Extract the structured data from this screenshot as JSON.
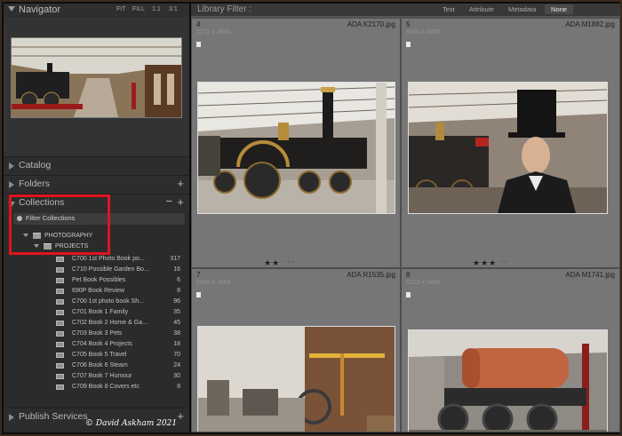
{
  "navigator": {
    "title": "Navigator",
    "zoom_options": [
      "FIT",
      "FILL",
      "1:1",
      "3:1"
    ]
  },
  "sections": {
    "catalog": "Catalog",
    "folders": "Folders",
    "collections": "Collections",
    "publish": "Publish Services"
  },
  "collections_panel": {
    "filter_label": "Filter Collections",
    "root": "PHOTOGRAPHY",
    "sub": "PROJECTS",
    "items": [
      {
        "name": "C700 1st Photo Book po...",
        "count": "317"
      },
      {
        "name": "C710 Possible Garden Bo...",
        "count": "16"
      },
      {
        "name": "Pet Book Possibles",
        "count": "6"
      },
      {
        "name": "690P Book Review",
        "count": "8"
      },
      {
        "name": "C700 1st photo book Sh...",
        "count": "96"
      },
      {
        "name": "C701 Book 1 Family",
        "count": "35"
      },
      {
        "name": "C702 Book 2 Home & Ga...",
        "count": "45"
      },
      {
        "name": "C703 Book 3 Pets",
        "count": "38"
      },
      {
        "name": "C704 Book 4 Projects",
        "count": "18"
      },
      {
        "name": "C705 Book 5 Travel",
        "count": "70"
      },
      {
        "name": "C706 Book 6 Steam",
        "count": "24"
      },
      {
        "name": "C707 Book 7 Humour",
        "count": "30"
      },
      {
        "name": "C709 Book 8 Covers etc",
        "count": "8"
      }
    ]
  },
  "library_filter": {
    "title": "Library Filter :",
    "options": [
      "Text",
      "Attribute",
      "Metadata",
      "None"
    ]
  },
  "grid": [
    {
      "index": "4",
      "filename": "ADA K2170.jpg",
      "dims": "5272 x 3856",
      "ext": "JPG",
      "stars": "★★",
      "rating": 2
    },
    {
      "index": "5",
      "filename": "ADA M1882.jpg",
      "dims": "6000 x 4000",
      "ext": "JPG",
      "stars": "★★★",
      "rating": 3
    },
    {
      "index": "7",
      "filename": "ADA R1535.jpg",
      "dims": "5040 x 3466",
      "ext": "JPG"
    },
    {
      "index": "8",
      "filename": "ADA M1741.jpg",
      "dims": "5212 x 3466",
      "ext": "JPG"
    }
  ],
  "watermark": "© David Askham 2021",
  "colors": {
    "highlight": "#e0141e",
    "panel_bg": "#2b2b2b",
    "grid_bg": "#565656",
    "cell_bg": "#767676"
  }
}
